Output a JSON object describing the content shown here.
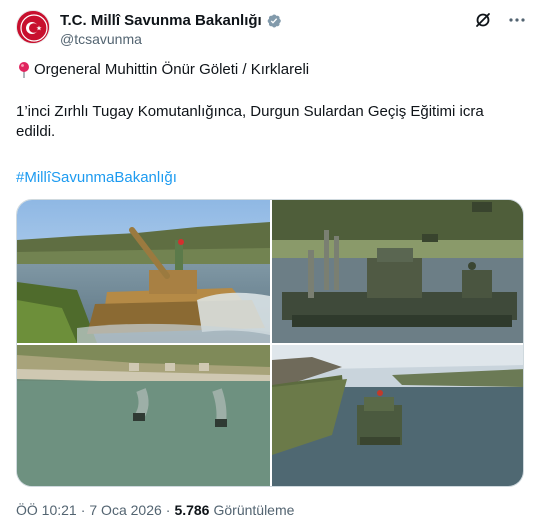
{
  "account": {
    "display_name": "T.C. Millî Savunma Bakanlığı",
    "handle": "@tcsavunma",
    "avatar_icon": "ministry-seal-icon",
    "verified_color": "#829aab"
  },
  "header_actions": {
    "grok_icon": "grok-icon",
    "more_icon": "more-dots-icon"
  },
  "post": {
    "location_icon": "round-pushpin-icon",
    "location": "Orgeneral Muhittin Önür Göleti / Kırklareli",
    "text": "1’inci Zırhlı Tugay Komutanlığınca, Durgun Sulardan Geçiş Eğitimi icra edildi.",
    "hashtag": "#MillîSavunmaBakanlığı"
  },
  "media": {
    "count": 4,
    "items": [
      "tank-fording-photo",
      "pontoon-vehicles-photo",
      "aerial-lake-tanks-photo",
      "ferry-on-lake-photo"
    ]
  },
  "meta": {
    "time": "ÖÖ 10:21",
    "separator": "·",
    "date": "7 Oca 2026",
    "views_count": "5.786",
    "views_label": "Görüntüleme"
  },
  "colors": {
    "accent": "#1d9bf0",
    "secondary_text": "#536471",
    "seal_red": "#c8102e"
  }
}
